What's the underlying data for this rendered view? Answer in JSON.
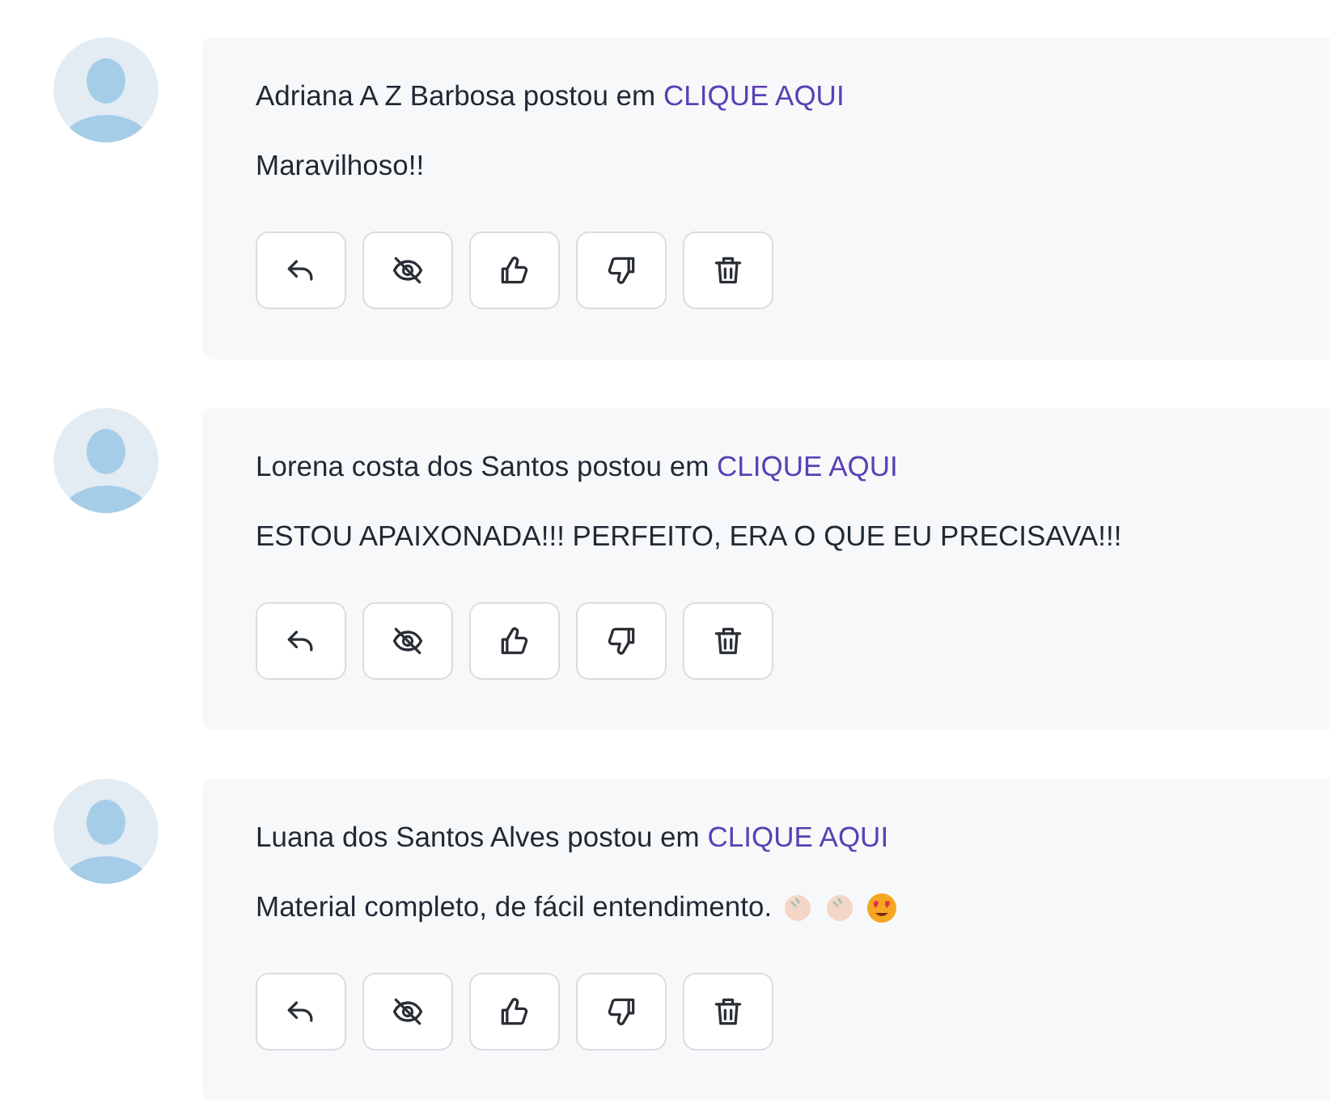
{
  "comments": [
    {
      "author": "Adriana A Z Barbosa",
      "verb": "postou em",
      "link": "CLIQUE AQUI",
      "text": "Maravilhoso!!",
      "actions": [
        {
          "kind": "reply"
        },
        {
          "kind": "hide"
        },
        {
          "kind": "like"
        },
        {
          "kind": "dislike"
        },
        {
          "kind": "delete"
        }
      ]
    },
    {
      "author": "Lorena costa dos Santos",
      "verb": "postou em",
      "link": "CLIQUE AQUI",
      "text": "ESTOU APAIXONADA!!! PERFEITO, ERA O QUE EU PRECISAVA!!!",
      "actions": [
        {
          "kind": "reply"
        },
        {
          "kind": "hide"
        },
        {
          "kind": "like"
        },
        {
          "kind": "dislike"
        },
        {
          "kind": "delete"
        }
      ]
    },
    {
      "author": "Luana dos Santos Alves",
      "verb": "postou em",
      "link": "CLIQUE AQUI",
      "text": "Material completo, de fácil entendimento.",
      "emojis": [
        {
          "kind": "clap"
        },
        {
          "kind": "clap"
        },
        {
          "kind": "heart-eyes"
        }
      ],
      "actions": [
        {
          "kind": "reply"
        },
        {
          "kind": "hide"
        },
        {
          "kind": "like"
        },
        {
          "kind": "dislike"
        },
        {
          "kind": "delete"
        }
      ]
    }
  ]
}
